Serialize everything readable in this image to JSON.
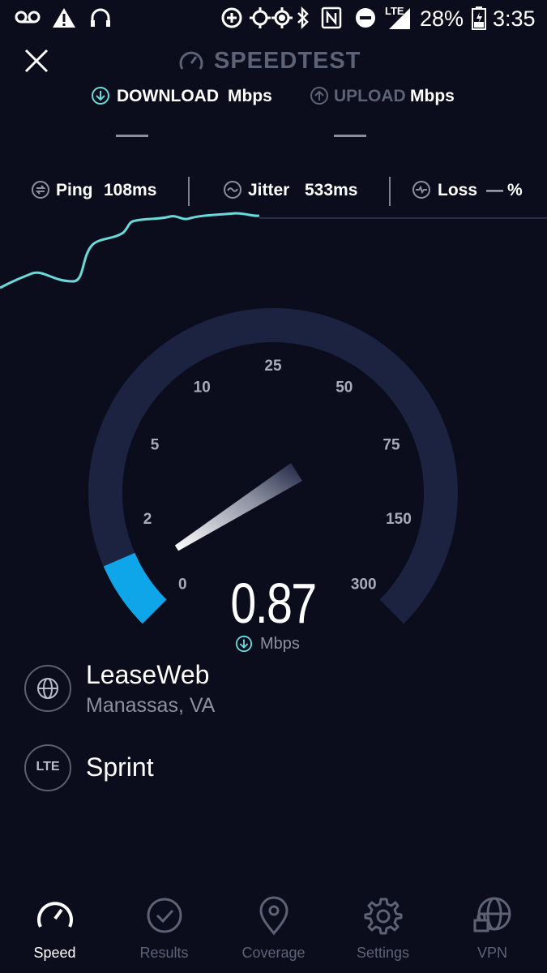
{
  "status_bar": {
    "battery": "28%",
    "time": "3:35",
    "network": "LTE"
  },
  "header": {
    "title": "SPEEDTEST"
  },
  "tabs": {
    "download": {
      "label": "DOWNLOAD",
      "unit": "Mbps",
      "value": "—"
    },
    "upload": {
      "label": "UPLOAD",
      "unit": "Mbps",
      "value": "—"
    }
  },
  "metrics": {
    "ping": {
      "label": "Ping",
      "value": "108ms"
    },
    "jitter": {
      "label": "Jitter",
      "value": "533ms"
    },
    "loss": {
      "label": "Loss",
      "value": "—",
      "unit": "%"
    }
  },
  "gauge": {
    "ticks": [
      "0",
      "2",
      "5",
      "10",
      "25",
      "50",
      "75",
      "150",
      "300"
    ],
    "reading": "0.87",
    "unit": "Mbps",
    "level": 0.03
  },
  "server": {
    "name": "LeaseWeb",
    "location": "Manassas, VA"
  },
  "carrier": {
    "badge": "LTE",
    "name": "Sprint"
  },
  "nav": [
    {
      "label": "Speed",
      "icon": "speedometer-icon",
      "active": true
    },
    {
      "label": "Results",
      "icon": "check-circle-icon",
      "active": false
    },
    {
      "label": "Coverage",
      "icon": "map-pin-icon",
      "active": false
    },
    {
      "label": "Settings",
      "icon": "gear-icon",
      "active": false
    },
    {
      "label": "VPN",
      "icon": "globe-lock-icon",
      "active": false
    }
  ],
  "colors": {
    "background": "#0b0d1d",
    "accent": "#6ad9d9",
    "gauge_fill": "#0ea5e9",
    "gauge_track": "#1c2340",
    "muted": "#5d6275"
  }
}
